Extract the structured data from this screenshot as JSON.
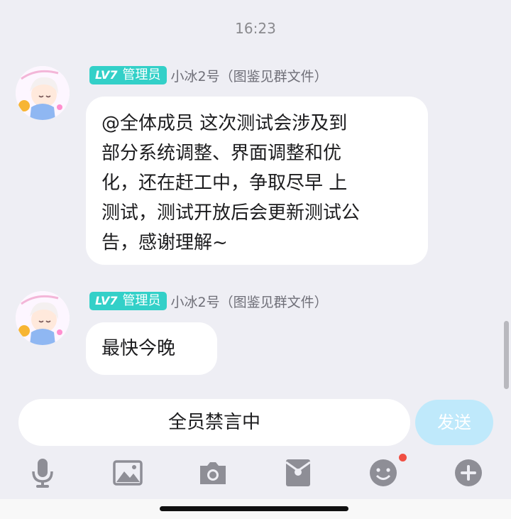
{
  "timestamp": "16:23",
  "messages": [
    {
      "badge_level": "LV7",
      "badge_role": "管理员",
      "sender": "小冰2号（图鉴见群文件）",
      "lines": [
        "@全体成员 这次测试会涉及到",
        "部分系统调整、界面调整和优",
        "化，还在赶工中，争取尽早 上",
        "测试，测试开放后会更新测试公",
        "告，感谢理解~"
      ]
    },
    {
      "badge_level": "LV7",
      "badge_role": "管理员",
      "sender": "小冰2号（图鉴见群文件）",
      "lines": [
        "最快今晚"
      ]
    }
  ],
  "input": {
    "status_text": "全员禁言中"
  },
  "send_button": {
    "label": "发送"
  },
  "toolbar": {
    "icons": [
      "microphone-icon",
      "image-icon",
      "camera-icon",
      "red-packet-icon",
      "emoji-icon",
      "plus-icon"
    ]
  },
  "colors": {
    "background": "#eeeef4",
    "badge": "#33d0c8",
    "send_button": "#bfe9fb",
    "notification_dot": "#f04f43",
    "icon": "#8e8e96"
  }
}
